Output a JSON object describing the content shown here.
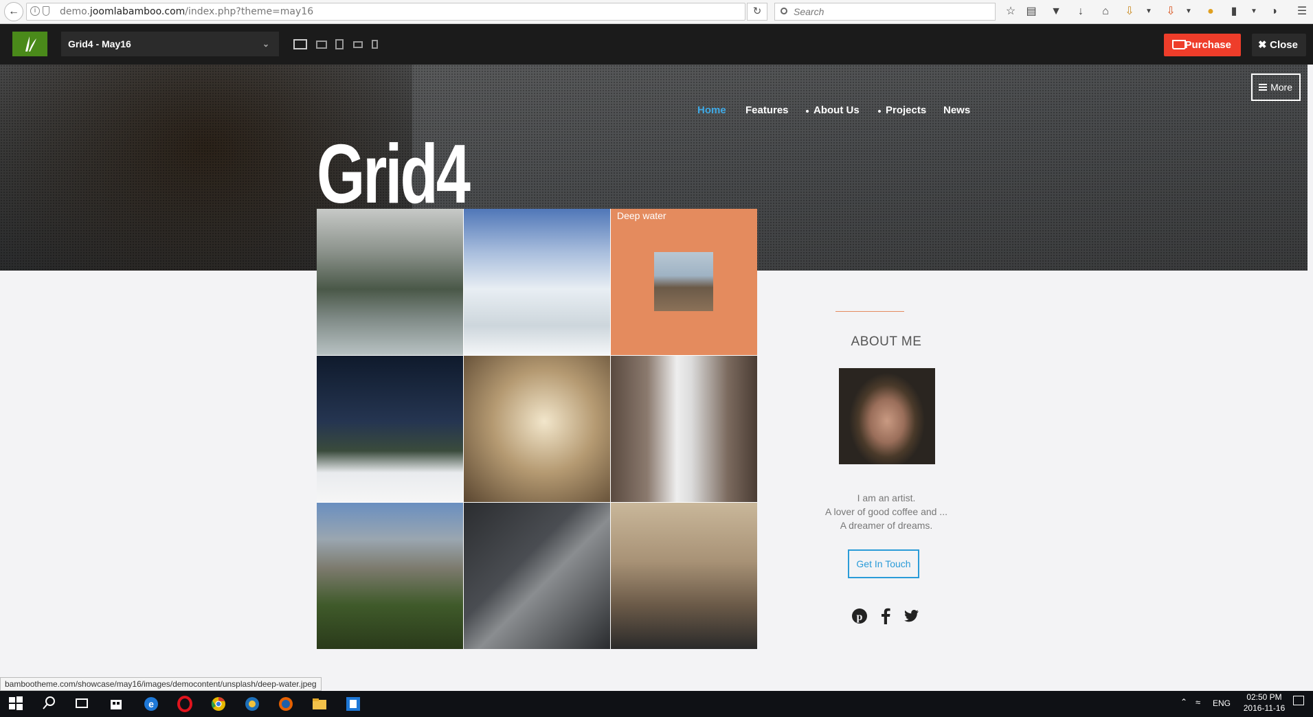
{
  "browser": {
    "url_prefix": "demo.",
    "url_host": "joomlabamboo.com",
    "url_path": "/index.php?theme=may16",
    "search_placeholder": "Search",
    "status_url": "bambootheme.com/showcase/may16/images/democontent/unsplash/deep-water.jpeg"
  },
  "demo_bar": {
    "theme_name": "Grid4 - May16",
    "purchase_label": "Purchase",
    "close_label": "Close"
  },
  "site": {
    "title": "Grid4",
    "more_label": "More",
    "nav": [
      {
        "label": "Home"
      },
      {
        "label": "Features"
      },
      {
        "label": "About Us"
      },
      {
        "label": "Projects"
      },
      {
        "label": "News"
      }
    ]
  },
  "grid": {
    "caption": "Deep water"
  },
  "sidebar": {
    "heading": "ABOUT ME",
    "bio": [
      "I am an artist.",
      "A lover of good coffee and ...",
      "A dreamer of dreams."
    ],
    "contact_label": "Get In Touch"
  },
  "taskbar": {
    "language": "ENG",
    "time": "02:50 PM",
    "date": "2016-11-16"
  },
  "colors": {
    "accent_blue": "#3fa9e5",
    "purchase_red": "#ee3d2a",
    "tile_orange": "#e48b5e",
    "brand_green": "#4a8a1a"
  }
}
